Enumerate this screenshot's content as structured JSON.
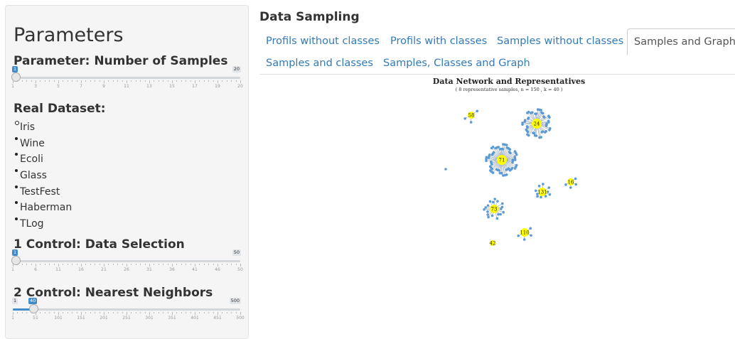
{
  "sidebar": {
    "title": "Parameters",
    "samples": {
      "label": "Parameter: Number of Samples",
      "min": "1",
      "max": "20",
      "value": "1",
      "ticks": [
        "1",
        "3",
        "5",
        "7",
        "9",
        "11",
        "13",
        "15",
        "17",
        "19",
        "20"
      ]
    },
    "dataset": {
      "label": "Real Dataset:",
      "options": [
        "Iris",
        "Wine",
        "Ecoli",
        "Glass",
        "TestFest",
        "Haberman",
        "TLog"
      ],
      "selected": "Iris"
    },
    "control1": {
      "label": "1 Control: Data Selection",
      "min": "1",
      "max": "50",
      "value": "1",
      "ticks": [
        "1",
        "6",
        "11",
        "16",
        "21",
        "26",
        "31",
        "36",
        "41",
        "46",
        "50"
      ]
    },
    "control2": {
      "label": "2 Control: Nearest Neighbors",
      "min": "1",
      "max": "500",
      "value": "40",
      "ticks": [
        "1",
        "51",
        "101",
        "151",
        "201",
        "251",
        "301",
        "351",
        "401",
        "451",
        "500"
      ]
    }
  },
  "main": {
    "title": "Data Sampling",
    "tabs": [
      {
        "label": "Profils without classes",
        "active": false
      },
      {
        "label": "Profils with classes",
        "active": false
      },
      {
        "label": "Samples without classes",
        "active": false
      },
      {
        "label": "Samples and Graph",
        "active": true
      },
      {
        "label": "Samples and classes",
        "active": false
      },
      {
        "label": "Samples, Classes and Graph",
        "active": false
      }
    ],
    "plot": {
      "title": "Data Network and Representatives",
      "subtitle": "( 8 representative samples, n = 150 , k = 40 )",
      "node_labels": [
        "58",
        "24",
        "71",
        "16",
        "131",
        "73",
        "110",
        "42"
      ],
      "hub_color": "#ffff00",
      "leaf_color": "#5b9bd5"
    }
  }
}
